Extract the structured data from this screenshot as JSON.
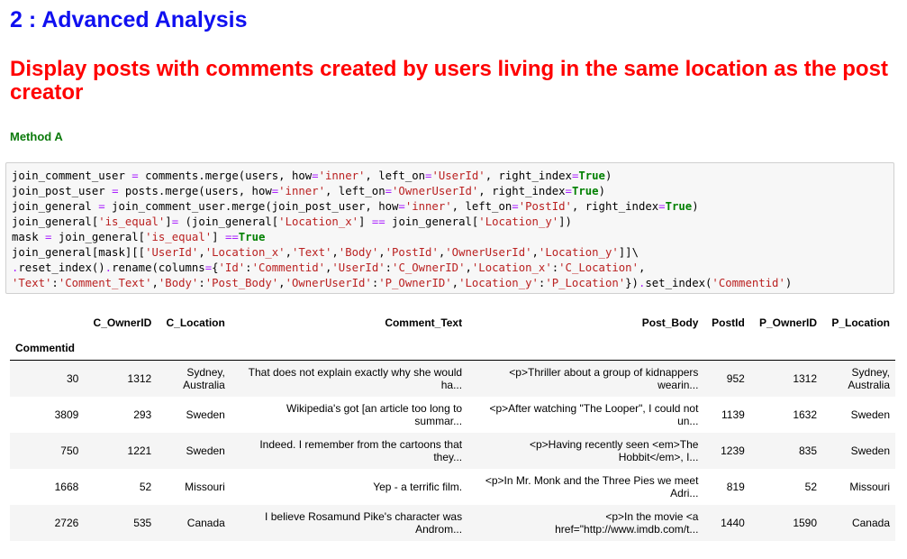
{
  "headings": {
    "section": "2 : Advanced Analysis",
    "title": "Display posts with comments created by users living in the same location as the post creator",
    "method": "Method A"
  },
  "code_lines": [
    [
      [
        "t",
        "join_comment_user "
      ],
      [
        "o",
        "="
      ],
      [
        "t",
        " comments.merge(users, how"
      ],
      [
        "o",
        "="
      ],
      [
        "s",
        "'inner'"
      ],
      [
        "t",
        ", left_on"
      ],
      [
        "o",
        "="
      ],
      [
        "s",
        "'UserId'"
      ],
      [
        "t",
        ", right_index"
      ],
      [
        "o",
        "="
      ],
      [
        "k",
        "True"
      ],
      [
        "t",
        ")"
      ]
    ],
    [
      [
        "t",
        "join_post_user "
      ],
      [
        "o",
        "="
      ],
      [
        "t",
        " posts.merge(users, how"
      ],
      [
        "o",
        "="
      ],
      [
        "s",
        "'inner'"
      ],
      [
        "t",
        ", left_on"
      ],
      [
        "o",
        "="
      ],
      [
        "s",
        "'OwnerUserId'"
      ],
      [
        "t",
        ", right_index"
      ],
      [
        "o",
        "="
      ],
      [
        "k",
        "True"
      ],
      [
        "t",
        ")"
      ]
    ],
    [
      [
        "t",
        "join_general "
      ],
      [
        "o",
        "="
      ],
      [
        "t",
        " join_comment_user.merge(join_post_user, how"
      ],
      [
        "o",
        "="
      ],
      [
        "s",
        "'inner'"
      ],
      [
        "t",
        ", left_on"
      ],
      [
        "o",
        "="
      ],
      [
        "s",
        "'PostId'"
      ],
      [
        "t",
        ", right_index"
      ],
      [
        "o",
        "="
      ],
      [
        "k",
        "True"
      ],
      [
        "t",
        ")"
      ]
    ],
    [
      [
        "t",
        "join_general["
      ],
      [
        "s",
        "'is_equal'"
      ],
      [
        "t",
        "]"
      ],
      [
        "o",
        "="
      ],
      [
        "t",
        " (join_general["
      ],
      [
        "s",
        "'Location_x'"
      ],
      [
        "t",
        "] "
      ],
      [
        "o",
        "=="
      ],
      [
        "t",
        " join_general["
      ],
      [
        "s",
        "'Location_y'"
      ],
      [
        "t",
        "])"
      ]
    ],
    [
      [
        "t",
        "mask "
      ],
      [
        "o",
        "="
      ],
      [
        "t",
        " join_general["
      ],
      [
        "s",
        "'is_equal'"
      ],
      [
        "t",
        "] "
      ],
      [
        "o",
        "=="
      ],
      [
        "k",
        "True"
      ]
    ],
    [
      [
        "t",
        "join_general[mask][["
      ],
      [
        "s",
        "'UserId'"
      ],
      [
        "t",
        ","
      ],
      [
        "s",
        "'Location_x'"
      ],
      [
        "t",
        ","
      ],
      [
        "s",
        "'Text'"
      ],
      [
        "t",
        ","
      ],
      [
        "s",
        "'Body'"
      ],
      [
        "t",
        ","
      ],
      [
        "s",
        "'PostId'"
      ],
      [
        "t",
        ","
      ],
      [
        "s",
        "'OwnerUserId'"
      ],
      [
        "t",
        ","
      ],
      [
        "s",
        "'Location_y'"
      ],
      [
        "t",
        "]]\\"
      ]
    ],
    [
      [
        "o",
        "."
      ],
      [
        "t",
        "reset_index()"
      ],
      [
        "o",
        "."
      ],
      [
        "t",
        "rename(columns"
      ],
      [
        "o",
        "="
      ],
      [
        "t",
        "{"
      ],
      [
        "s",
        "'Id'"
      ],
      [
        "t",
        ":"
      ],
      [
        "s",
        "'Commentid'"
      ],
      [
        "t",
        ","
      ],
      [
        "s",
        "'UserId'"
      ],
      [
        "t",
        ":"
      ],
      [
        "s",
        "'C_OwnerID'"
      ],
      [
        "t",
        ","
      ],
      [
        "s",
        "'Location_x'"
      ],
      [
        "t",
        ":"
      ],
      [
        "s",
        "'C_Location'"
      ],
      [
        "t",
        ","
      ]
    ],
    [
      [
        "s",
        "'Text'"
      ],
      [
        "t",
        ":"
      ],
      [
        "s",
        "'Comment_Text'"
      ],
      [
        "t",
        ","
      ],
      [
        "s",
        "'Body'"
      ],
      [
        "t",
        ":"
      ],
      [
        "s",
        "'Post_Body'"
      ],
      [
        "t",
        ","
      ],
      [
        "s",
        "'OwnerUserId'"
      ],
      [
        "t",
        ":"
      ],
      [
        "s",
        "'P_OwnerID'"
      ],
      [
        "t",
        ","
      ],
      [
        "s",
        "'Location_y'"
      ],
      [
        "t",
        ":"
      ],
      [
        "s",
        "'P_Location'"
      ],
      [
        "t",
        "})"
      ],
      [
        "o",
        "."
      ],
      [
        "t",
        "set_index("
      ],
      [
        "s",
        "'Commentid'"
      ],
      [
        "t",
        ")"
      ]
    ]
  ],
  "table": {
    "columns": [
      "C_OwnerID",
      "C_Location",
      "Comment_Text",
      "Post_Body",
      "PostId",
      "P_OwnerID",
      "P_Location"
    ],
    "index_name": "Commentid",
    "rows": [
      {
        "index": "30",
        "cells": [
          "1312",
          "Sydney,\nAustralia",
          "That does not explain exactly why she would\nha...",
          "<p>Thriller about a group of kidnappers\nwearin...",
          "952",
          "1312",
          "Sydney,\nAustralia"
        ]
      },
      {
        "index": "3809",
        "cells": [
          "293",
          "Sweden",
          "Wikipedia's got [an article too long to\nsummar...",
          "<p>After watching \"The Looper\", I could not\nun...",
          "1139",
          "1632",
          "Sweden"
        ]
      },
      {
        "index": "750",
        "cells": [
          "1221",
          "Sweden",
          "Indeed. I remember from the cartoons that\nthey...",
          "<p>Having recently seen <em>The\nHobbit</em>, I...",
          "1239",
          "835",
          "Sweden"
        ]
      },
      {
        "index": "1668",
        "cells": [
          "52",
          "Missouri",
          "Yep - a terrific film.",
          "<p>In Mr. Monk and the Three Pies we meet\nAdri...",
          "819",
          "52",
          "Missouri"
        ]
      },
      {
        "index": "2726",
        "cells": [
          "535",
          "Canada",
          "I believe Rosamund Pike's character was\nAndrom...",
          "<p>In the movie <a\nhref=\"http://www.imdb.com/t...",
          "1440",
          "1590",
          "Canada"
        ]
      }
    ]
  }
}
